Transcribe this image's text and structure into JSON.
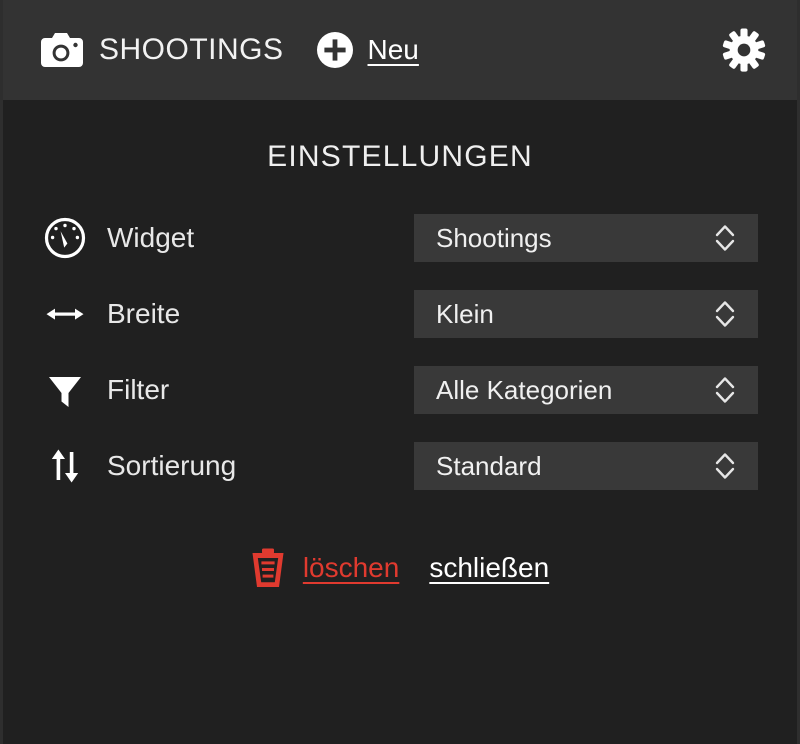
{
  "header": {
    "camera_icon": "camera-icon",
    "title": "SHOOTINGS",
    "new_icon": "plus-circle-icon",
    "new_label": "Neu",
    "settings_icon": "gear-icon"
  },
  "panel": {
    "title": "EINSTELLUNGEN",
    "rows": [
      {
        "icon": "gauge-icon",
        "label": "Widget",
        "value": "Shootings",
        "stepper_icon": "chevron-up-down-icon"
      },
      {
        "icon": "arrows-horizontal-icon",
        "label": "Breite",
        "value": "Klein",
        "stepper_icon": "chevron-up-down-icon"
      },
      {
        "icon": "funnel-icon",
        "label": "Filter",
        "value": "Alle Kategorien",
        "stepper_icon": "chevron-up-down-icon"
      },
      {
        "icon": "sort-arrows-icon",
        "label": "Sortierung",
        "value": "Standard",
        "stepper_icon": "chevron-up-down-icon"
      }
    ],
    "actions": {
      "delete_icon": "trash-icon",
      "delete_label": "löschen",
      "close_label": "schließen"
    }
  },
  "colors": {
    "header_bg": "#333333",
    "panel_bg": "#202020",
    "select_bg": "#393939",
    "text": "#f0f0f0",
    "danger": "#e03a2f"
  }
}
